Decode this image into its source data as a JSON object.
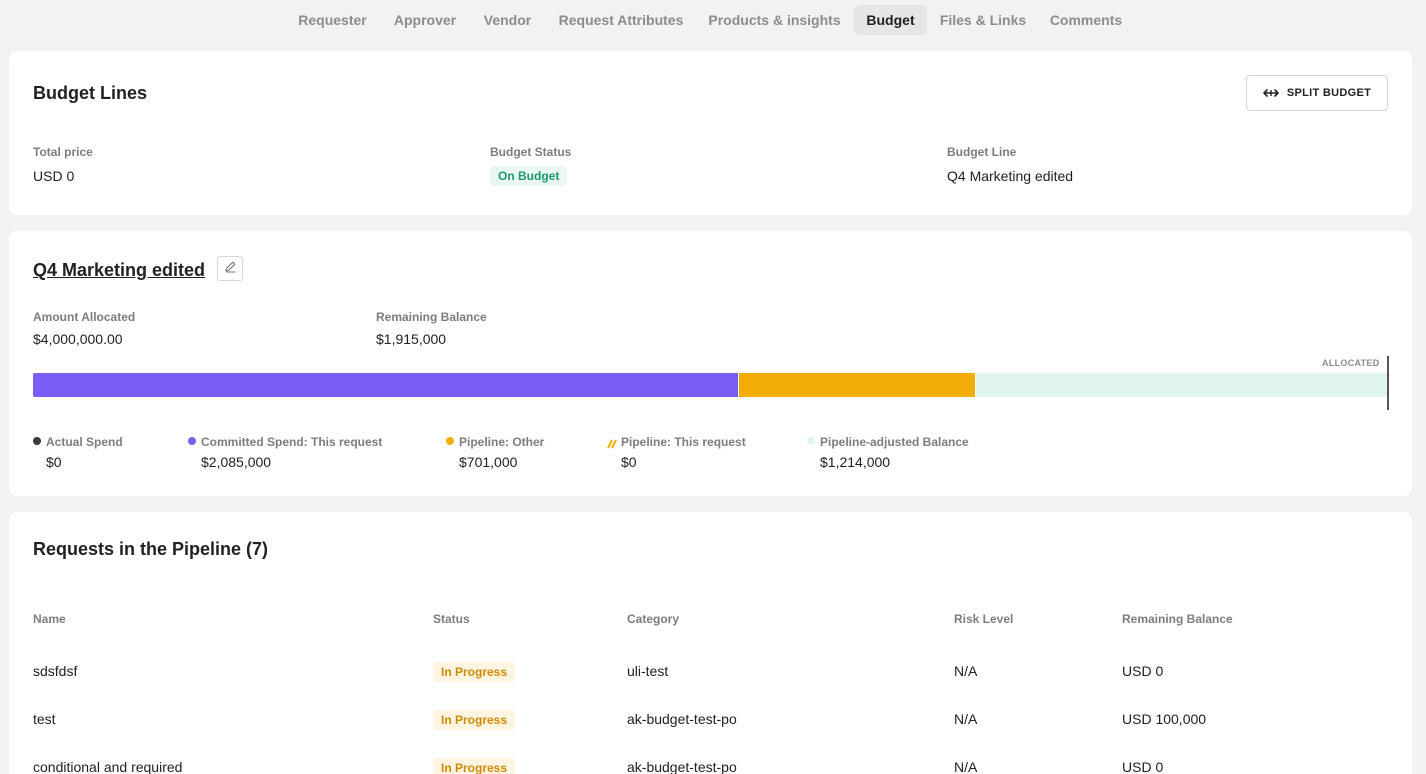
{
  "tabs": [
    {
      "label": "Requester"
    },
    {
      "label": "Approver"
    },
    {
      "label": "Vendor"
    },
    {
      "label": "Request Attributes"
    },
    {
      "label": "Products & insights"
    },
    {
      "label": "Budget",
      "active": true
    },
    {
      "label": "Files & Links"
    },
    {
      "label": "Comments"
    }
  ],
  "budget_lines": {
    "title": "Budget Lines",
    "split_button": "SPLIT BUDGET",
    "split_icon": "split-arrows-icon",
    "total_price_label": "Total price",
    "total_price_value": "USD 0",
    "status_label": "Budget Status",
    "status_value": "On Budget",
    "budget_line_label": "Budget Line",
    "budget_line_value": "Q4 Marketing edited"
  },
  "budget_detail": {
    "title": "Q4 Marketing edited",
    "edit_icon": "pencil-icon",
    "allocated_label": "Amount Allocated",
    "allocated_value": "$4,000,000.00",
    "remaining_label": "Remaining Balance",
    "remaining_value": "$1,915,000",
    "bar_marker_label": "ALLOCATED",
    "bar": {
      "total": 4000000,
      "segments": [
        {
          "name": "committed",
          "value": 2085000,
          "color": "#7b5cf6"
        },
        {
          "name": "pipeline-other",
          "value": 701000,
          "color": "#f2ae06"
        },
        {
          "name": "pipeline-adjusted-balance",
          "value": 1214000,
          "color": "#dff5ee"
        }
      ]
    },
    "legend": [
      {
        "label": "Actual Spend",
        "value": "$0",
        "color": "#3a3a3a",
        "style": "dot"
      },
      {
        "label": "Committed Spend: This request",
        "value": "$2,085,000",
        "color": "#7b5cf6",
        "style": "dot"
      },
      {
        "label": "Pipeline: Other",
        "value": "$701,000",
        "color": "#f2ae06",
        "style": "dot"
      },
      {
        "label": "Pipeline: This request",
        "value": "$0",
        "color": "#f2ae06",
        "style": "striped"
      },
      {
        "label": "Pipeline-adjusted Balance",
        "value": "$1,214,000",
        "color": "#dff5ee",
        "style": "dot"
      }
    ]
  },
  "pipeline": {
    "title": "Requests in the Pipeline (7)",
    "columns": [
      "Name",
      "Status",
      "Category",
      "Risk Level",
      "Remaining Balance"
    ],
    "rows": [
      {
        "name": "sdsfdsf",
        "status": "In Progress",
        "category": "uli-test",
        "risk": "N/A",
        "remaining": "USD 0"
      },
      {
        "name": "test",
        "status": "In Progress",
        "category": "ak-budget-test-po",
        "risk": "N/A",
        "remaining": "USD 100,000"
      },
      {
        "name": "conditional and required",
        "status": "In Progress",
        "category": "ak-budget-test-po",
        "risk": "N/A",
        "remaining": "USD 0"
      }
    ]
  }
}
